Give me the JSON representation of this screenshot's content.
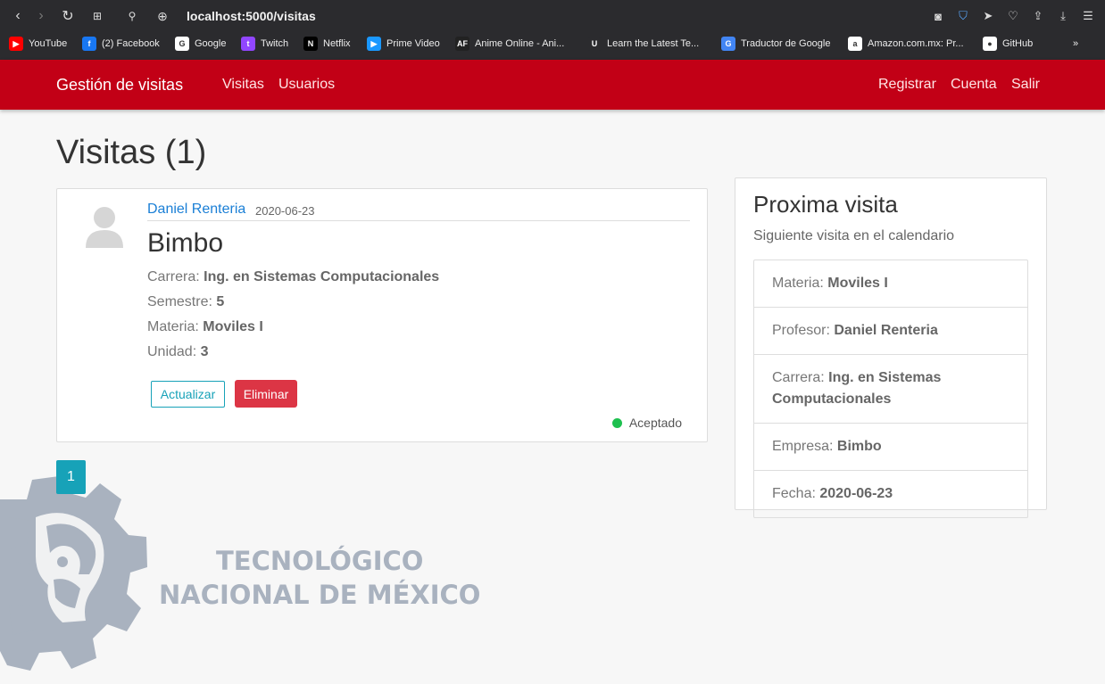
{
  "browser": {
    "url": "localhost:5000/visitas",
    "bookmarks": [
      {
        "label": "YouTube",
        "icon": "youtube-icon",
        "color": "#ff0000",
        "glyph": "▶"
      },
      {
        "label": "(2) Facebook",
        "icon": "facebook-icon",
        "color": "#1877f2",
        "glyph": "f"
      },
      {
        "label": "Google",
        "icon": "google-icon",
        "color": "#ffffff",
        "glyph": "G"
      },
      {
        "label": "Twitch",
        "icon": "twitch-icon",
        "color": "#9146ff",
        "glyph": "t"
      },
      {
        "label": "Netflix",
        "icon": "netflix-icon",
        "color": "#000000",
        "glyph": "N"
      },
      {
        "label": "Prime Video",
        "icon": "prime-video-icon",
        "color": "#1a98ff",
        "glyph": "▶"
      },
      {
        "label": "Anime Online - Ani...",
        "icon": "animeflv-icon",
        "color": "#222222",
        "glyph": "AF"
      },
      {
        "label": "Learn the Latest Te...",
        "icon": "udemy-icon",
        "color": "#2b2b2e",
        "glyph": "U"
      },
      {
        "label": "Traductor de Google",
        "icon": "google-translate-icon",
        "color": "#4285f4",
        "glyph": "G"
      },
      {
        "label": "Amazon.com.mx: Pr...",
        "icon": "amazon-icon",
        "color": "#ffffff",
        "glyph": "a"
      },
      {
        "label": "GitHub",
        "icon": "github-icon",
        "color": "#ffffff",
        "glyph": "●"
      }
    ],
    "more_glyph": "»"
  },
  "navbar": {
    "brand": "Gestión de visitas",
    "left_links": [
      "Visitas",
      "Usuarios"
    ],
    "right_links": [
      "Registrar",
      "Cuenta",
      "Salir"
    ]
  },
  "page": {
    "title": "Visitas (1)"
  },
  "visit": {
    "user": "Daniel Renteria",
    "date": "2020-06-23",
    "company": "Bimbo",
    "fields": [
      {
        "label": "Carrera: ",
        "value": "Ing. en Sistemas Computacionales"
      },
      {
        "label": "Semestre: ",
        "value": "5"
      },
      {
        "label": "Materia: ",
        "value": "Moviles I"
      },
      {
        "label": "Unidad: ",
        "value": "3"
      }
    ],
    "update_label": "Actualizar",
    "delete_label": "Eliminar",
    "status": "Aceptado",
    "status_color": "#1ec04f"
  },
  "pagination": {
    "current": "1"
  },
  "next_visit": {
    "title": "Proxima visita",
    "subtitle": "Siguiente visita en el calendario",
    "items": [
      {
        "label": "Materia: ",
        "value": "Moviles I"
      },
      {
        "label": "Profesor: ",
        "value": "Daniel Renteria"
      },
      {
        "label": "Carrera: ",
        "value": "Ing. en Sistemas Computacionales"
      },
      {
        "label": "Empresa: ",
        "value": "Bimbo"
      },
      {
        "label": "Fecha: ",
        "value": "2020-06-23"
      }
    ]
  },
  "logo": {
    "line1": "TECNOLÓGICO",
    "line2": "NACIONAL DE MÉXICO"
  },
  "colors": {
    "navbar": "#c20016",
    "primary_link": "#1a7fd6",
    "info": "#17a2b8",
    "danger": "#dc3545"
  }
}
